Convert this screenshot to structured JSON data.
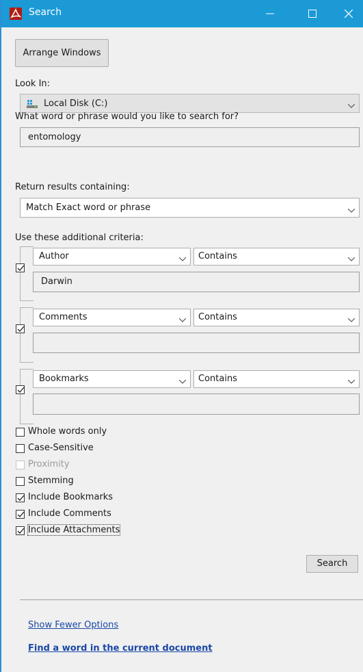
{
  "window": {
    "title": "Search",
    "app_icon": "acrobat-icon",
    "titlebar_color": "#1b9ad6"
  },
  "arrange_windows_label": "Arrange Windows",
  "look_in": {
    "label": "Look In:",
    "value": "Local Disk (C:)",
    "icon": "drive-icon"
  },
  "query": {
    "label": "What word or phrase would you like to search for?",
    "value": "entomology"
  },
  "results": {
    "label": "Return results containing:",
    "value": "Match Exact word or phrase"
  },
  "criteria": {
    "label": "Use these additional criteria:",
    "rows": [
      {
        "checked": true,
        "field": "Author",
        "operator": "Contains",
        "value": "Darwin"
      },
      {
        "checked": true,
        "field": "Comments",
        "operator": "Contains",
        "value": ""
      },
      {
        "checked": true,
        "field": "Bookmarks",
        "operator": "Contains",
        "value": ""
      }
    ]
  },
  "options": [
    {
      "label": "Whole words only",
      "checked": false,
      "disabled": false
    },
    {
      "label": "Case-Sensitive",
      "checked": false,
      "disabled": false
    },
    {
      "label": "Proximity",
      "checked": false,
      "disabled": true
    },
    {
      "label": "Stemming",
      "checked": false,
      "disabled": false
    },
    {
      "label": "Include Bookmarks",
      "checked": true,
      "disabled": false
    },
    {
      "label": "Include Comments",
      "checked": true,
      "disabled": false
    },
    {
      "label": "Include Attachments",
      "checked": true,
      "disabled": false
    }
  ],
  "search_label": "Search",
  "links": {
    "fewer_options": "Show Fewer Options",
    "find_in_document": "Find a word in the current document"
  }
}
